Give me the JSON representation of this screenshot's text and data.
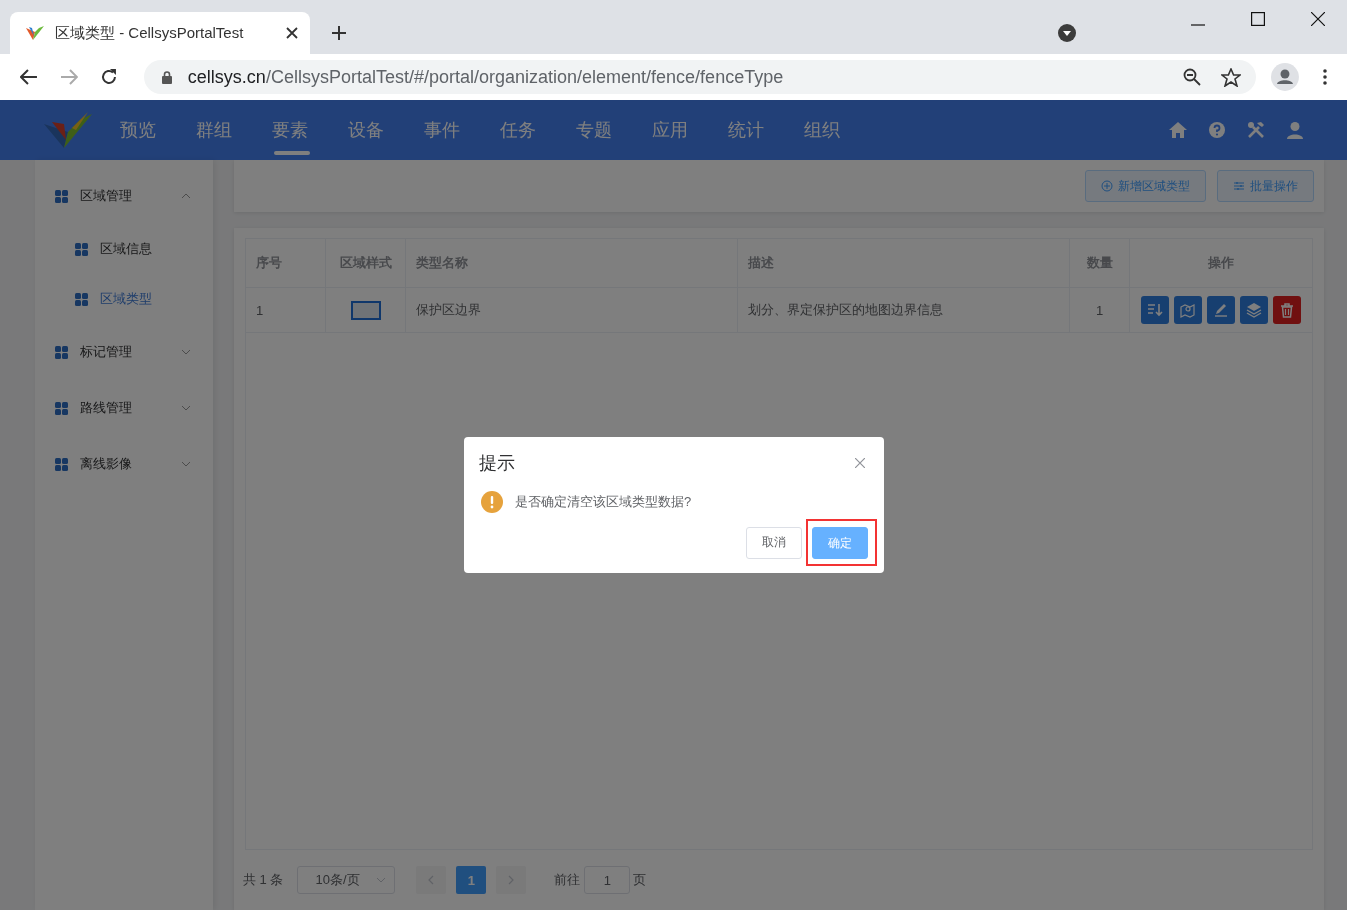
{
  "browser": {
    "tab_title": "区域类型 - CellsysPortalTest",
    "url_host": "cellsys.cn",
    "url_path": "/CellsysPortalTest/#/portal/organization/element/fence/fenceType",
    "forward_disabled": true
  },
  "nav": {
    "items": [
      {
        "label": "预览",
        "selected": false
      },
      {
        "label": "群组",
        "selected": false
      },
      {
        "label": "要素",
        "selected": true
      },
      {
        "label": "设备",
        "selected": false
      },
      {
        "label": "事件",
        "selected": false
      },
      {
        "label": "任务",
        "selected": false
      },
      {
        "label": "专题",
        "selected": false
      },
      {
        "label": "应用",
        "selected": false
      },
      {
        "label": "统计",
        "selected": false
      },
      {
        "label": "组织",
        "selected": false
      }
    ]
  },
  "sidebar": {
    "items": [
      {
        "label": "区域管理",
        "expanded": true,
        "selected": false,
        "children": [
          {
            "label": "区域信息",
            "selected": false
          },
          {
            "label": "区域类型",
            "selected": true
          }
        ]
      },
      {
        "label": "标记管理",
        "expanded": false,
        "selected": false
      },
      {
        "label": "路线管理",
        "expanded": false,
        "selected": false
      },
      {
        "label": "离线影像",
        "expanded": false,
        "selected": false
      }
    ]
  },
  "toolbar": {
    "buttons": [
      {
        "label": "新增区域类型",
        "kind": "add"
      },
      {
        "label": "批量操作",
        "kind": "batch"
      }
    ]
  },
  "table": {
    "columns": [
      "序号",
      "区域样式",
      "类型名称",
      "描述",
      "数量",
      "操作"
    ],
    "rows": [
      {
        "index": "1",
        "name": "保护区边界",
        "description": "划分、界定保护区的地图边界信息",
        "count": "1",
        "actions": [
          {
            "kind": "sort"
          },
          {
            "kind": "map"
          },
          {
            "kind": "edit"
          },
          {
            "kind": "layers"
          },
          {
            "kind": "delete"
          }
        ]
      }
    ]
  },
  "pagination": {
    "total": "共 1 条",
    "page_size": "10条/页",
    "prev_disabled": true,
    "next_disabled": true,
    "pages": [
      {
        "label": "1",
        "selected": true
      }
    ],
    "goto_label": "前往",
    "goto_value": "1",
    "goto_suffix": "页"
  },
  "dialog": {
    "title": "提示",
    "message": "是否确定清空该区域类型数据?",
    "cancel": "取消",
    "confirm": "确定",
    "confirm_highlighted": true
  }
}
